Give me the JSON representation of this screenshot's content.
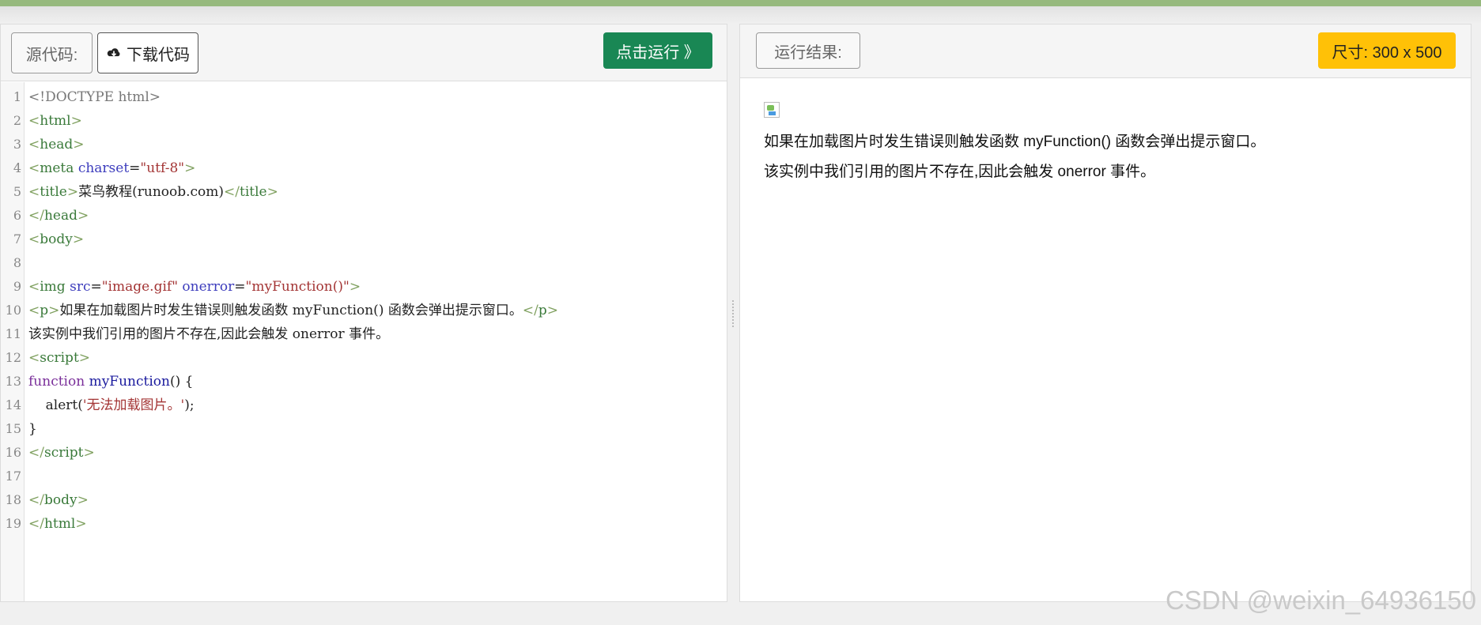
{
  "colors": {
    "topbar": "#96b97d",
    "run": "#198754",
    "size": "#ffc107"
  },
  "editor": {
    "source_label": "源代码:",
    "download_label": "下载代码",
    "download_icon": "cloud-download-icon",
    "run_label": "点击运行 》",
    "lines": [
      {
        "n": "1",
        "parts": [
          [
            "gray",
            "<!DOCTYPE html>"
          ]
        ]
      },
      {
        "n": "2",
        "parts": [
          [
            "tag",
            "<"
          ],
          [
            "tagb",
            "html"
          ],
          [
            "tag",
            ">"
          ]
        ]
      },
      {
        "n": "3",
        "parts": [
          [
            "tag",
            "<"
          ],
          [
            "tagb",
            "head"
          ],
          [
            "tag",
            ">"
          ]
        ]
      },
      {
        "n": "4",
        "parts": [
          [
            "tag",
            "<"
          ],
          [
            "tagb",
            "meta "
          ],
          [
            "attr",
            "charset"
          ],
          [
            "txt",
            "="
          ],
          [
            "str",
            "\"utf-8\""
          ],
          [
            "tag",
            ">"
          ]
        ]
      },
      {
        "n": "5",
        "parts": [
          [
            "tag",
            "<"
          ],
          [
            "tagb",
            "title"
          ],
          [
            "tag",
            ">"
          ],
          [
            "txt",
            "菜鸟教程(runoob.com)"
          ],
          [
            "tag",
            "</"
          ],
          [
            "tagb",
            "title"
          ],
          [
            "tag",
            ">"
          ]
        ]
      },
      {
        "n": "6",
        "parts": [
          [
            "tag",
            "</"
          ],
          [
            "tagb",
            "head"
          ],
          [
            "tag",
            ">"
          ]
        ]
      },
      {
        "n": "7",
        "parts": [
          [
            "tag",
            "<"
          ],
          [
            "tagb",
            "body"
          ],
          [
            "tag",
            ">"
          ]
        ]
      },
      {
        "n": "8",
        "parts": []
      },
      {
        "n": "9",
        "parts": [
          [
            "tag",
            "<"
          ],
          [
            "tagb",
            "img "
          ],
          [
            "attr",
            "src"
          ],
          [
            "txt",
            "="
          ],
          [
            "str",
            "\"image.gif\" "
          ],
          [
            "attr",
            "onerror"
          ],
          [
            "txt",
            "="
          ],
          [
            "str",
            "\"myFunction()\""
          ],
          [
            "tag",
            ">"
          ]
        ]
      },
      {
        "n": "10",
        "parts": [
          [
            "tag",
            "<"
          ],
          [
            "tagb",
            "p"
          ],
          [
            "tag",
            ">"
          ],
          [
            "txt",
            "如果在加载图片时发生错误则触发函数 myFunction() 函数会弹出提示窗口。"
          ],
          [
            "tag",
            "</"
          ],
          [
            "tagb",
            "p"
          ],
          [
            "tag",
            ">"
          ]
        ]
      },
      {
        "n": "11",
        "parts": [
          [
            "txt",
            "该实例中我们引用的图片不存在,因此会触发 onerror 事件。"
          ]
        ]
      },
      {
        "n": "12",
        "parts": [
          [
            "tag",
            "<"
          ],
          [
            "tagb",
            "script"
          ],
          [
            "tag",
            ">"
          ]
        ]
      },
      {
        "n": "13",
        "parts": [
          [
            "kw",
            "function "
          ],
          [
            "fn",
            "myFunction"
          ],
          [
            "txt",
            "() {"
          ]
        ]
      },
      {
        "n": "14",
        "parts": [
          [
            "txt",
            "    alert("
          ],
          [
            "str",
            "'无法加载图片。'"
          ],
          [
            "txt",
            ");"
          ]
        ]
      },
      {
        "n": "15",
        "parts": [
          [
            "txt",
            "}"
          ]
        ]
      },
      {
        "n": "16",
        "parts": [
          [
            "tag",
            "</"
          ],
          [
            "tagb",
            "script"
          ],
          [
            "tag",
            ">"
          ]
        ]
      },
      {
        "n": "17",
        "parts": []
      },
      {
        "n": "18",
        "parts": [
          [
            "tag",
            "</"
          ],
          [
            "tagb",
            "body"
          ],
          [
            "tag",
            ">"
          ]
        ]
      },
      {
        "n": "19",
        "parts": [
          [
            "tag",
            "</"
          ],
          [
            "tagb",
            "html"
          ],
          [
            "tag",
            ">"
          ]
        ]
      }
    ]
  },
  "result": {
    "label": "运行结果:",
    "size_label": "尺寸: 300 x 500",
    "broken_image_icon": "broken-image-icon",
    "para1": "如果在加载图片时发生错误则触发函数 myFunction() 函数会弹出提示窗口。",
    "para2": "该实例中我们引用的图片不存在,因此会触发 onerror 事件。"
  },
  "watermark": "CSDN @weixin_64936150"
}
